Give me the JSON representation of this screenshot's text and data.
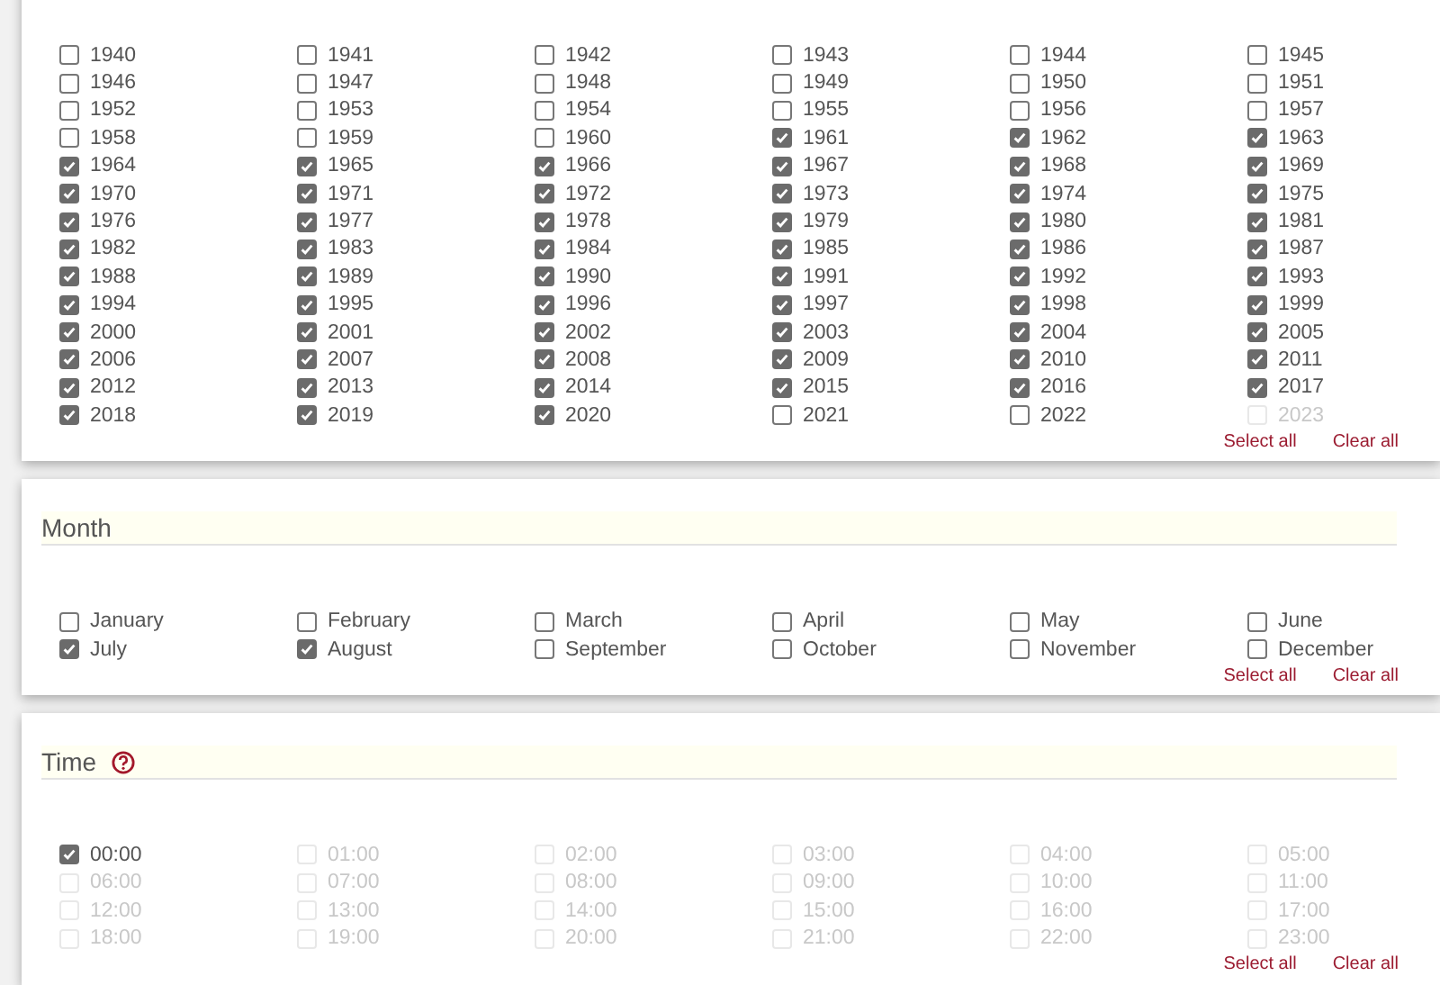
{
  "sections": [
    {
      "actions": [
        "Select all",
        "Clear all"
      ],
      "items": [
        {
          "label": "1940",
          "checked": false,
          "disabled": false
        },
        {
          "label": "1941",
          "checked": false,
          "disabled": false
        },
        {
          "label": "1942",
          "checked": false,
          "disabled": false
        },
        {
          "label": "1943",
          "checked": false,
          "disabled": false
        },
        {
          "label": "1944",
          "checked": false,
          "disabled": false
        },
        {
          "label": "1945",
          "checked": false,
          "disabled": false
        },
        {
          "label": "1946",
          "checked": false,
          "disabled": false
        },
        {
          "label": "1947",
          "checked": false,
          "disabled": false
        },
        {
          "label": "1948",
          "checked": false,
          "disabled": false
        },
        {
          "label": "1949",
          "checked": false,
          "disabled": false
        },
        {
          "label": "1950",
          "checked": false,
          "disabled": false
        },
        {
          "label": "1951",
          "checked": false,
          "disabled": false
        },
        {
          "label": "1952",
          "checked": false,
          "disabled": false
        },
        {
          "label": "1953",
          "checked": false,
          "disabled": false
        },
        {
          "label": "1954",
          "checked": false,
          "disabled": false
        },
        {
          "label": "1955",
          "checked": false,
          "disabled": false
        },
        {
          "label": "1956",
          "checked": false,
          "disabled": false
        },
        {
          "label": "1957",
          "checked": false,
          "disabled": false
        },
        {
          "label": "1958",
          "checked": false,
          "disabled": false
        },
        {
          "label": "1959",
          "checked": false,
          "disabled": false
        },
        {
          "label": "1960",
          "checked": false,
          "disabled": false
        },
        {
          "label": "1961",
          "checked": true,
          "disabled": false
        },
        {
          "label": "1962",
          "checked": true,
          "disabled": false
        },
        {
          "label": "1963",
          "checked": true,
          "disabled": false
        },
        {
          "label": "1964",
          "checked": true,
          "disabled": false
        },
        {
          "label": "1965",
          "checked": true,
          "disabled": false
        },
        {
          "label": "1966",
          "checked": true,
          "disabled": false
        },
        {
          "label": "1967",
          "checked": true,
          "disabled": false
        },
        {
          "label": "1968",
          "checked": true,
          "disabled": false
        },
        {
          "label": "1969",
          "checked": true,
          "disabled": false
        },
        {
          "label": "1970",
          "checked": true,
          "disabled": false
        },
        {
          "label": "1971",
          "checked": true,
          "disabled": false
        },
        {
          "label": "1972",
          "checked": true,
          "disabled": false
        },
        {
          "label": "1973",
          "checked": true,
          "disabled": false
        },
        {
          "label": "1974",
          "checked": true,
          "disabled": false
        },
        {
          "label": "1975",
          "checked": true,
          "disabled": false
        },
        {
          "label": "1976",
          "checked": true,
          "disabled": false
        },
        {
          "label": "1977",
          "checked": true,
          "disabled": false
        },
        {
          "label": "1978",
          "checked": true,
          "disabled": false
        },
        {
          "label": "1979",
          "checked": true,
          "disabled": false
        },
        {
          "label": "1980",
          "checked": true,
          "disabled": false
        },
        {
          "label": "1981",
          "checked": true,
          "disabled": false
        },
        {
          "label": "1982",
          "checked": true,
          "disabled": false
        },
        {
          "label": "1983",
          "checked": true,
          "disabled": false
        },
        {
          "label": "1984",
          "checked": true,
          "disabled": false
        },
        {
          "label": "1985",
          "checked": true,
          "disabled": false
        },
        {
          "label": "1986",
          "checked": true,
          "disabled": false
        },
        {
          "label": "1987",
          "checked": true,
          "disabled": false
        },
        {
          "label": "1988",
          "checked": true,
          "disabled": false
        },
        {
          "label": "1989",
          "checked": true,
          "disabled": false
        },
        {
          "label": "1990",
          "checked": true,
          "disabled": false
        },
        {
          "label": "1991",
          "checked": true,
          "disabled": false
        },
        {
          "label": "1992",
          "checked": true,
          "disabled": false
        },
        {
          "label": "1993",
          "checked": true,
          "disabled": false
        },
        {
          "label": "1994",
          "checked": true,
          "disabled": false
        },
        {
          "label": "1995",
          "checked": true,
          "disabled": false
        },
        {
          "label": "1996",
          "checked": true,
          "disabled": false
        },
        {
          "label": "1997",
          "checked": true,
          "disabled": false
        },
        {
          "label": "1998",
          "checked": true,
          "disabled": false
        },
        {
          "label": "1999",
          "checked": true,
          "disabled": false
        },
        {
          "label": "2000",
          "checked": true,
          "disabled": false
        },
        {
          "label": "2001",
          "checked": true,
          "disabled": false
        },
        {
          "label": "2002",
          "checked": true,
          "disabled": false
        },
        {
          "label": "2003",
          "checked": true,
          "disabled": false
        },
        {
          "label": "2004",
          "checked": true,
          "disabled": false
        },
        {
          "label": "2005",
          "checked": true,
          "disabled": false
        },
        {
          "label": "2006",
          "checked": true,
          "disabled": false
        },
        {
          "label": "2007",
          "checked": true,
          "disabled": false
        },
        {
          "label": "2008",
          "checked": true,
          "disabled": false
        },
        {
          "label": "2009",
          "checked": true,
          "disabled": false
        },
        {
          "label": "2010",
          "checked": true,
          "disabled": false
        },
        {
          "label": "2011",
          "checked": true,
          "disabled": false
        },
        {
          "label": "2012",
          "checked": true,
          "disabled": false
        },
        {
          "label": "2013",
          "checked": true,
          "disabled": false
        },
        {
          "label": "2014",
          "checked": true,
          "disabled": false
        },
        {
          "label": "2015",
          "checked": true,
          "disabled": false
        },
        {
          "label": "2016",
          "checked": true,
          "disabled": false
        },
        {
          "label": "2017",
          "checked": true,
          "disabled": false
        },
        {
          "label": "2018",
          "checked": true,
          "disabled": false
        },
        {
          "label": "2019",
          "checked": true,
          "disabled": false
        },
        {
          "label": "2020",
          "checked": true,
          "disabled": false
        },
        {
          "label": "2021",
          "checked": false,
          "disabled": false
        },
        {
          "label": "2022",
          "checked": false,
          "disabled": false
        },
        {
          "label": "2023",
          "checked": false,
          "disabled": true
        }
      ]
    },
    {
      "title": "Month",
      "actions": [
        "Select all",
        "Clear all"
      ],
      "items": [
        {
          "label": "January",
          "checked": false,
          "disabled": false
        },
        {
          "label": "February",
          "checked": false,
          "disabled": false
        },
        {
          "label": "March",
          "checked": false,
          "disabled": false
        },
        {
          "label": "April",
          "checked": false,
          "disabled": false
        },
        {
          "label": "May",
          "checked": false,
          "disabled": false
        },
        {
          "label": "June",
          "checked": false,
          "disabled": false
        },
        {
          "label": "July",
          "checked": true,
          "disabled": false
        },
        {
          "label": "August",
          "checked": true,
          "disabled": false
        },
        {
          "label": "September",
          "checked": false,
          "disabled": false
        },
        {
          "label": "October",
          "checked": false,
          "disabled": false
        },
        {
          "label": "November",
          "checked": false,
          "disabled": false
        },
        {
          "label": "December",
          "checked": false,
          "disabled": false
        }
      ]
    },
    {
      "title": "Time",
      "help_icon": true,
      "actions": [
        "Select all",
        "Clear all"
      ],
      "items": [
        {
          "label": "00:00",
          "checked": true,
          "disabled": false
        },
        {
          "label": "01:00",
          "checked": false,
          "disabled": true
        },
        {
          "label": "02:00",
          "checked": false,
          "disabled": true
        },
        {
          "label": "03:00",
          "checked": false,
          "disabled": true
        },
        {
          "label": "04:00",
          "checked": false,
          "disabled": true
        },
        {
          "label": "05:00",
          "checked": false,
          "disabled": true
        },
        {
          "label": "06:00",
          "checked": false,
          "disabled": true
        },
        {
          "label": "07:00",
          "checked": false,
          "disabled": true
        },
        {
          "label": "08:00",
          "checked": false,
          "disabled": true
        },
        {
          "label": "09:00",
          "checked": false,
          "disabled": true
        },
        {
          "label": "10:00",
          "checked": false,
          "disabled": true
        },
        {
          "label": "11:00",
          "checked": false,
          "disabled": true
        },
        {
          "label": "12:00",
          "checked": false,
          "disabled": true
        },
        {
          "label": "13:00",
          "checked": false,
          "disabled": true
        },
        {
          "label": "14:00",
          "checked": false,
          "disabled": true
        },
        {
          "label": "15:00",
          "checked": false,
          "disabled": true
        },
        {
          "label": "16:00",
          "checked": false,
          "disabled": true
        },
        {
          "label": "17:00",
          "checked": false,
          "disabled": true
        },
        {
          "label": "18:00",
          "checked": false,
          "disabled": true
        },
        {
          "label": "19:00",
          "checked": false,
          "disabled": true
        },
        {
          "label": "20:00",
          "checked": false,
          "disabled": true
        },
        {
          "label": "21:00",
          "checked": false,
          "disabled": true
        },
        {
          "label": "22:00",
          "checked": false,
          "disabled": true
        },
        {
          "label": "23:00",
          "checked": false,
          "disabled": true
        }
      ]
    }
  ]
}
